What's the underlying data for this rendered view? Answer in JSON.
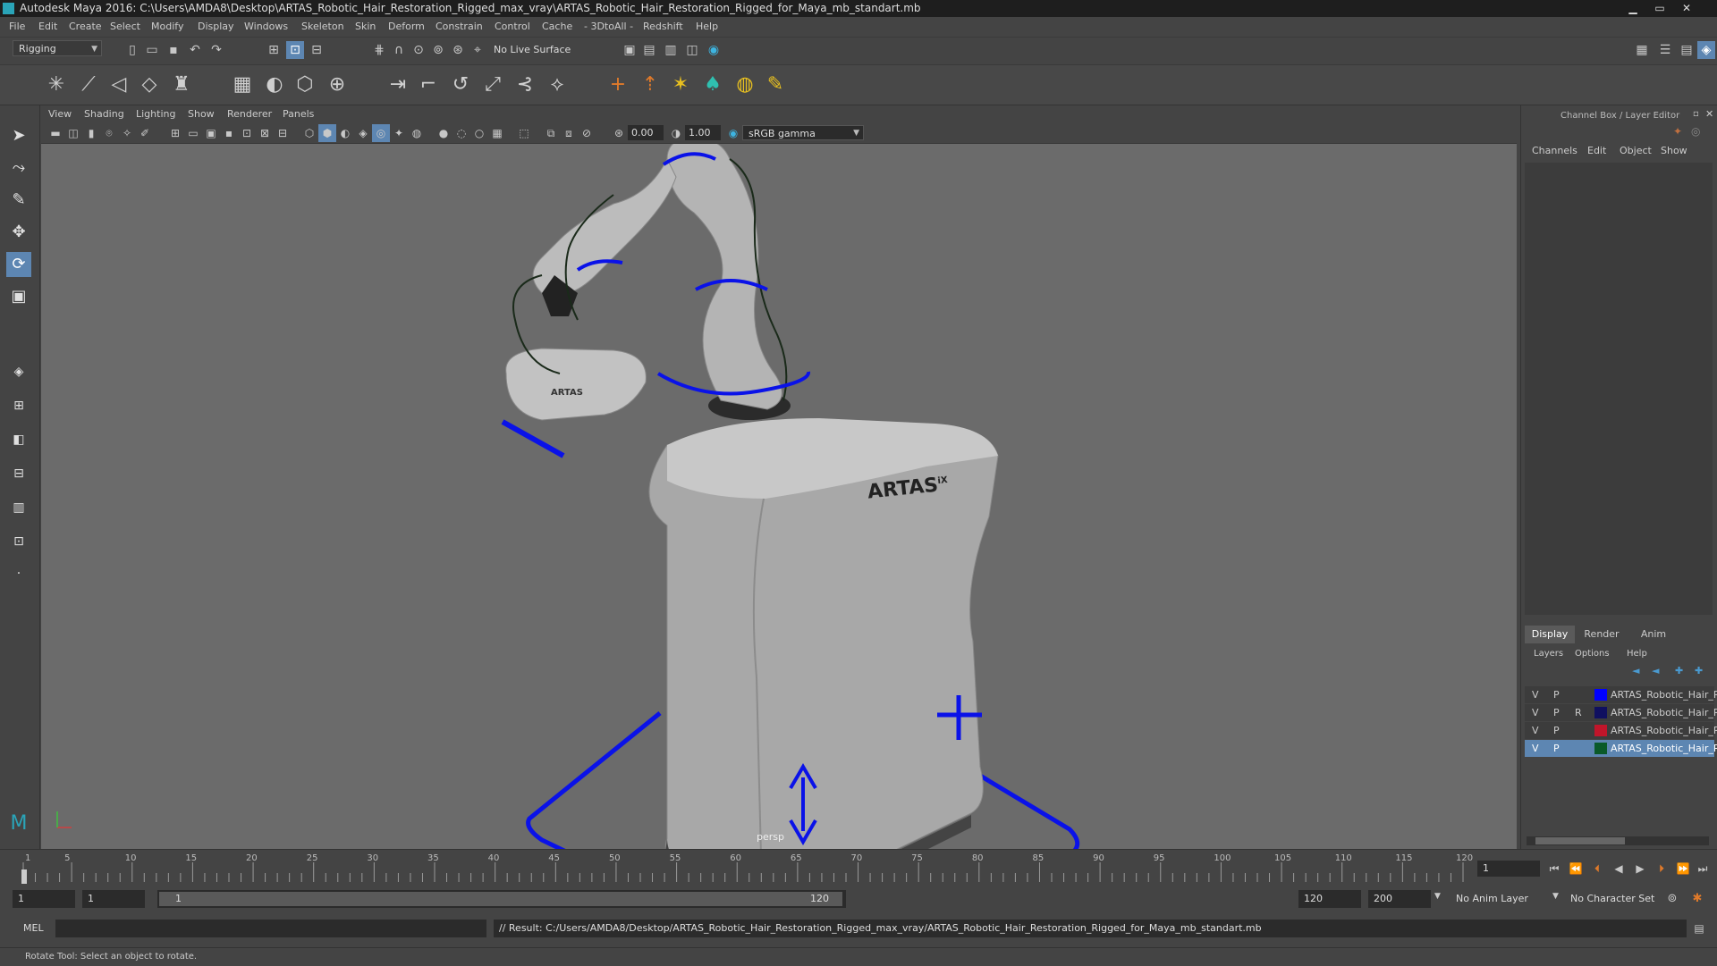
{
  "window": {
    "title": "Autodesk Maya 2016: C:\\Users\\AMDA8\\Desktop\\ARTAS_Robotic_Hair_Restoration_Rigged_max_vray\\ARTAS_Robotic_Hair_Restoration_Rigged_for_Maya_mb_standart.mb"
  },
  "menubar": {
    "items": [
      "File",
      "Edit",
      "Create",
      "Select",
      "Modify",
      "Display",
      "Windows",
      "Skeleton",
      "Skin",
      "Deform",
      "Constrain",
      "Control",
      "Cache",
      "- 3DtoAll -",
      "Redshift",
      "Help"
    ]
  },
  "statusline": {
    "menuset": "Rigging",
    "live_surface": "No Live Surface"
  },
  "viewport": {
    "menu": [
      "View",
      "Shading",
      "Lighting",
      "Show",
      "Renderer",
      "Panels"
    ],
    "exposure": "0.00",
    "gamma": "1.00",
    "colorspace": "sRGB gamma",
    "camera_label": "persp",
    "brand_tablet": "ARTAS",
    "brand_cabinet": "ARTAS",
    "brand_cabinet_suffix": "iX"
  },
  "channelbox": {
    "title": "Channel Box / Layer Editor",
    "menu": [
      "Channels",
      "Edit",
      "Object",
      "Show"
    ]
  },
  "layer_editor": {
    "tabs": [
      "Display",
      "Render",
      "Anim"
    ],
    "menu": [
      "Layers",
      "Options",
      "Help"
    ],
    "layers": [
      {
        "v": "V",
        "p": "P",
        "r": "",
        "name": "ARTAS_Robotic_Hair_R",
        "color": "#0000ff",
        "selected": false
      },
      {
        "v": "V",
        "p": "P",
        "r": "R",
        "name": "ARTAS_Robotic_Hair_R",
        "color": "#101060",
        "selected": false
      },
      {
        "v": "V",
        "p": "P",
        "r": "",
        "name": "ARTAS_Robotic_Hair_R",
        "color": "#c0152a",
        "selected": false
      },
      {
        "v": "V",
        "p": "P",
        "r": "",
        "name": "ARTAS_Robotic_Hair_R",
        "color": "#0a5a2a",
        "selected": true
      }
    ]
  },
  "timeslider": {
    "ticks": [
      "1",
      "5",
      "10",
      "15",
      "20",
      "25",
      "30",
      "35",
      "40",
      "45",
      "50",
      "55",
      "60",
      "65",
      "70",
      "75",
      "80",
      "85",
      "90",
      "95",
      "100",
      "105",
      "110",
      "115",
      "120"
    ],
    "current_frame": "1"
  },
  "range": {
    "start": "1",
    "playback_start": "1",
    "slider_start": "1",
    "slider_end": "120",
    "playback_end": "120",
    "end": "200",
    "anim_layer": "No Anim Layer",
    "character_set": "No Character Set"
  },
  "commandline": {
    "language": "MEL",
    "result": "// Result: C:/Users/AMDA8/Desktop/ARTAS_Robotic_Hair_Restoration_Rigged_max_vray/ARTAS_Robotic_Hair_Restoration_Rigged_for_Maya_mb_standart.mb"
  },
  "helpline": {
    "text": "Rotate Tool: Select an object to rotate."
  }
}
